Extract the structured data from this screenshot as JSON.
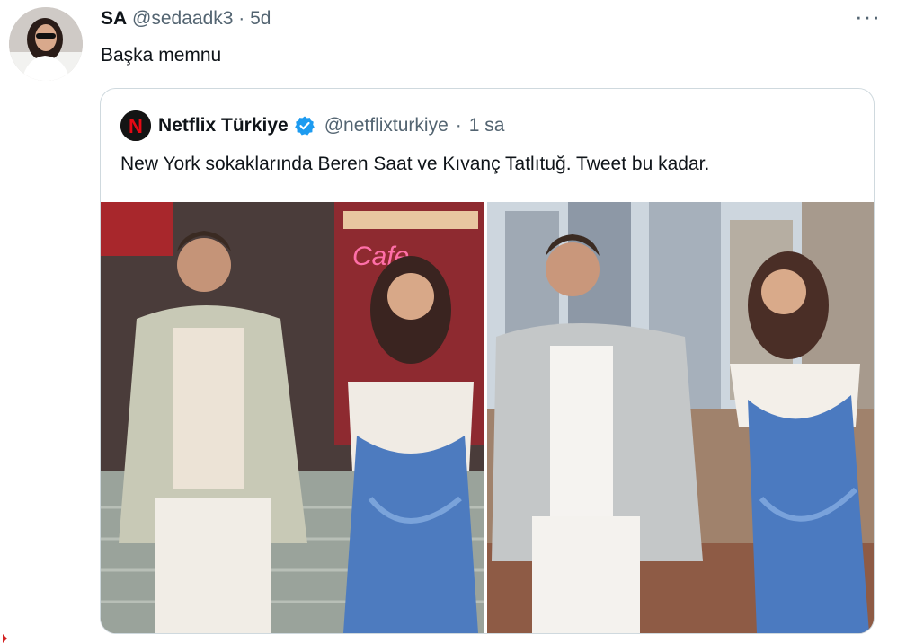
{
  "tweet": {
    "display_name": "SA",
    "handle": "@sedaadk3",
    "separator": "·",
    "time": "5d",
    "text": "Başka memnu",
    "more_label": "···"
  },
  "quoted": {
    "display_name": "Netflix Türkiye",
    "handle": "@netflixturkiye",
    "separator": "·",
    "time": "1 sa",
    "text": "New York sokaklarında Beren Saat ve Kıvanç Tatlıtuğ. Tweet bu kadar.",
    "logo_letter": "N",
    "sign_text": "Cafe"
  },
  "colors": {
    "verified": "#1d9bf0",
    "netflix_red": "#e50914",
    "secondary_text": "#536471",
    "border": "#cfd9de"
  },
  "icons": [
    "more-icon",
    "netflix-logo-icon",
    "verified-badge-icon"
  ]
}
